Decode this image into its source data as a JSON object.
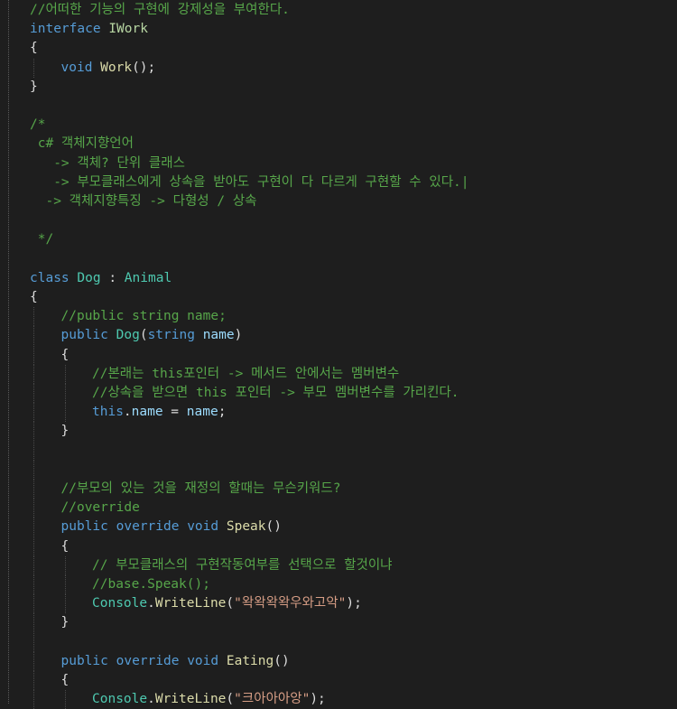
{
  "editor": {
    "lines": [
      {
        "indent": 0,
        "guides": 0,
        "tokens": [
          {
            "t": "//어떠한 기능의 구현에 강제성을 부여한다.",
            "c": "c"
          }
        ]
      },
      {
        "indent": 0,
        "guides": 0,
        "tokens": [
          {
            "t": "interface",
            "c": "k"
          },
          {
            "t": " ",
            "c": "p"
          },
          {
            "t": "IWork",
            "c": "i"
          }
        ]
      },
      {
        "indent": 0,
        "guides": 0,
        "tokens": [
          {
            "t": "{",
            "c": "p"
          }
        ]
      },
      {
        "indent": 1,
        "guides": 1,
        "tokens": [
          {
            "t": "void",
            "c": "k"
          },
          {
            "t": " ",
            "c": "p"
          },
          {
            "t": "Work",
            "c": "m"
          },
          {
            "t": "();",
            "c": "p"
          }
        ]
      },
      {
        "indent": 0,
        "guides": 0,
        "tokens": [
          {
            "t": "}",
            "c": "p"
          }
        ]
      },
      {
        "indent": 0,
        "guides": 0,
        "tokens": []
      },
      {
        "indent": 0,
        "guides": 0,
        "tokens": [
          {
            "t": "/*",
            "c": "c"
          }
        ]
      },
      {
        "indent": 0,
        "guides": 0,
        "tokens": [
          {
            "t": " c# 객체지향언어",
            "c": "c"
          }
        ]
      },
      {
        "indent": 0,
        "guides": 0,
        "tokens": [
          {
            "t": "   -> 객체? 단위 클래스",
            "c": "c"
          }
        ]
      },
      {
        "indent": 0,
        "guides": 0,
        "tokens": [
          {
            "t": "   -> 부모클래스에게 상속을 받아도 구현이 다 다르게 구현할 수 있다.|",
            "c": "c"
          }
        ]
      },
      {
        "indent": 0,
        "guides": 0,
        "tokens": [
          {
            "t": "  -> 객체지향특징 -> 다형성 / 상속",
            "c": "c"
          }
        ]
      },
      {
        "indent": 0,
        "guides": 0,
        "tokens": []
      },
      {
        "indent": 0,
        "guides": 0,
        "tokens": [
          {
            "t": " */",
            "c": "c"
          }
        ]
      },
      {
        "indent": 0,
        "guides": 0,
        "tokens": []
      },
      {
        "indent": 0,
        "guides": 0,
        "tokens": [
          {
            "t": "class",
            "c": "k"
          },
          {
            "t": " ",
            "c": "p"
          },
          {
            "t": "Dog",
            "c": "t"
          },
          {
            "t": " : ",
            "c": "p"
          },
          {
            "t": "Animal",
            "c": "t"
          }
        ]
      },
      {
        "indent": 0,
        "guides": 0,
        "tokens": [
          {
            "t": "{",
            "c": "p"
          }
        ]
      },
      {
        "indent": 1,
        "guides": 1,
        "tokens": [
          {
            "t": "//public string name;",
            "c": "c"
          }
        ]
      },
      {
        "indent": 1,
        "guides": 1,
        "tokens": [
          {
            "t": "public",
            "c": "k"
          },
          {
            "t": " ",
            "c": "p"
          },
          {
            "t": "Dog",
            "c": "t"
          },
          {
            "t": "(",
            "c": "p"
          },
          {
            "t": "string",
            "c": "k"
          },
          {
            "t": " ",
            "c": "p"
          },
          {
            "t": "name",
            "c": "v"
          },
          {
            "t": ")",
            "c": "p"
          }
        ]
      },
      {
        "indent": 1,
        "guides": 1,
        "tokens": [
          {
            "t": "{",
            "c": "p"
          }
        ]
      },
      {
        "indent": 2,
        "guides": 2,
        "tokens": [
          {
            "t": "//본래는 this포인터 -> 메서드 안에서는 멤버변수",
            "c": "c"
          }
        ]
      },
      {
        "indent": 2,
        "guides": 2,
        "tokens": [
          {
            "t": "//상속을 받으면 this 포인터 -> 부모 멤버변수를 가리킨다.",
            "c": "c"
          }
        ]
      },
      {
        "indent": 2,
        "guides": 2,
        "tokens": [
          {
            "t": "this",
            "c": "k"
          },
          {
            "t": ".",
            "c": "p"
          },
          {
            "t": "name",
            "c": "v"
          },
          {
            "t": " = ",
            "c": "p"
          },
          {
            "t": "name",
            "c": "v"
          },
          {
            "t": ";",
            "c": "p"
          }
        ]
      },
      {
        "indent": 1,
        "guides": 1,
        "tokens": [
          {
            "t": "}",
            "c": "p"
          }
        ]
      },
      {
        "indent": 0,
        "guides": 1,
        "tokens": []
      },
      {
        "indent": 0,
        "guides": 1,
        "tokens": []
      },
      {
        "indent": 1,
        "guides": 1,
        "tokens": [
          {
            "t": "//부모의 있는 것을 재정의 할때는 무슨키워드?",
            "c": "c"
          }
        ]
      },
      {
        "indent": 1,
        "guides": 1,
        "tokens": [
          {
            "t": "//override",
            "c": "c"
          }
        ]
      },
      {
        "indent": 1,
        "guides": 1,
        "tokens": [
          {
            "t": "public",
            "c": "k"
          },
          {
            "t": " ",
            "c": "p"
          },
          {
            "t": "override",
            "c": "k"
          },
          {
            "t": " ",
            "c": "p"
          },
          {
            "t": "void",
            "c": "k"
          },
          {
            "t": " ",
            "c": "p"
          },
          {
            "t": "Speak",
            "c": "m"
          },
          {
            "t": "()",
            "c": "p"
          }
        ]
      },
      {
        "indent": 1,
        "guides": 1,
        "tokens": [
          {
            "t": "{",
            "c": "p"
          }
        ]
      },
      {
        "indent": 2,
        "guides": 2,
        "tokens": [
          {
            "t": "// 부모클래스의 구현작동여부를 선택으로 할것이냐",
            "c": "c"
          }
        ]
      },
      {
        "indent": 2,
        "guides": 2,
        "tokens": [
          {
            "t": "//base.Speak();",
            "c": "c"
          }
        ]
      },
      {
        "indent": 2,
        "guides": 2,
        "tokens": [
          {
            "t": "Console",
            "c": "t"
          },
          {
            "t": ".",
            "c": "p"
          },
          {
            "t": "WriteLine",
            "c": "m"
          },
          {
            "t": "(",
            "c": "p"
          },
          {
            "t": "\"왁왁왁왁우와고악\"",
            "c": "s"
          },
          {
            "t": ");",
            "c": "p"
          }
        ]
      },
      {
        "indent": 1,
        "guides": 1,
        "tokens": [
          {
            "t": "}",
            "c": "p"
          }
        ]
      },
      {
        "indent": 0,
        "guides": 1,
        "tokens": []
      },
      {
        "indent": 1,
        "guides": 1,
        "tokens": [
          {
            "t": "public",
            "c": "k"
          },
          {
            "t": " ",
            "c": "p"
          },
          {
            "t": "override",
            "c": "k"
          },
          {
            "t": " ",
            "c": "p"
          },
          {
            "t": "void",
            "c": "k"
          },
          {
            "t": " ",
            "c": "p"
          },
          {
            "t": "Eating",
            "c": "m"
          },
          {
            "t": "()",
            "c": "p"
          }
        ]
      },
      {
        "indent": 1,
        "guides": 1,
        "tokens": [
          {
            "t": "{",
            "c": "p"
          }
        ]
      },
      {
        "indent": 2,
        "guides": 2,
        "tokens": [
          {
            "t": "Console",
            "c": "t"
          },
          {
            "t": ".",
            "c": "p"
          },
          {
            "t": "WriteLine",
            "c": "m"
          },
          {
            "t": "(",
            "c": "p"
          },
          {
            "t": "\"크아아아앙\"",
            "c": "s"
          },
          {
            "t": ");",
            "c": "p"
          }
        ]
      }
    ]
  }
}
